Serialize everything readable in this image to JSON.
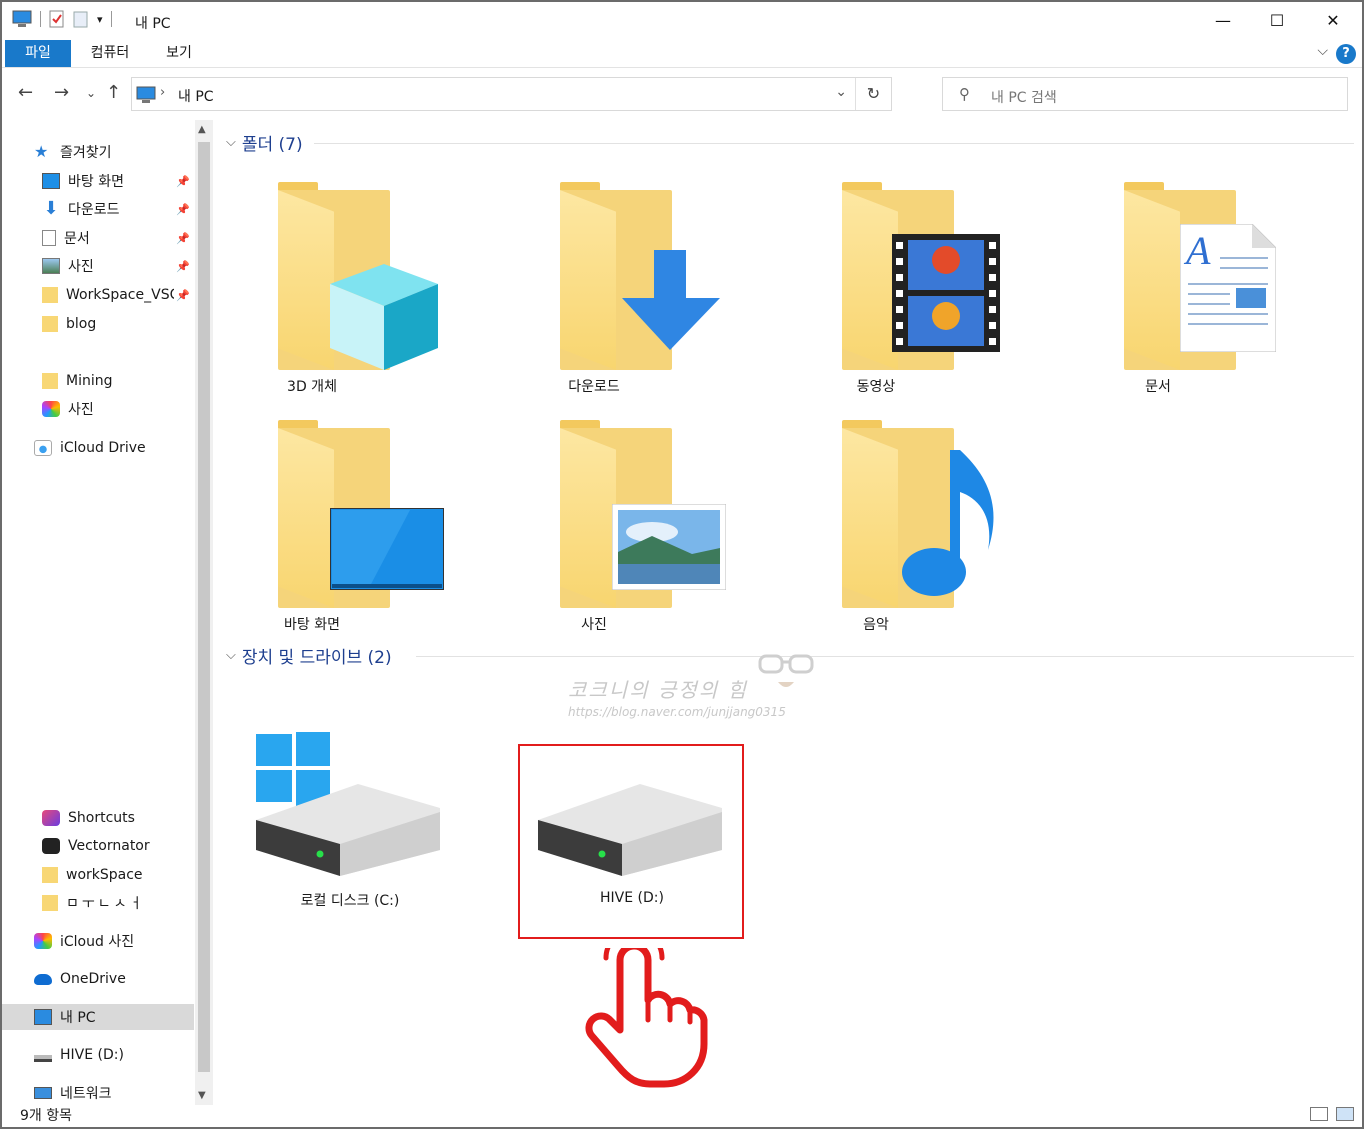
{
  "window": {
    "title": "내 PC",
    "controls": {
      "minimize": "—",
      "maximize": "☐",
      "close": "✕"
    }
  },
  "ribbon": {
    "tabs": [
      {
        "label": "파일",
        "active": true
      },
      {
        "label": "컴퓨터",
        "active": false
      },
      {
        "label": "보기",
        "active": false
      }
    ],
    "help": "?"
  },
  "address": {
    "crumb": "내 PC",
    "refresh": "↻"
  },
  "search": {
    "placeholder": "내 PC 검색"
  },
  "nav_pane": {
    "items": [
      {
        "label": "즐겨찾기",
        "icon": "star-icon"
      },
      {
        "label": "바탕 화면",
        "icon": "desktop-icon",
        "pinned": true
      },
      {
        "label": "다운로드",
        "icon": "download-icon",
        "pinned": true
      },
      {
        "label": "문서",
        "icon": "document-icon",
        "pinned": true
      },
      {
        "label": "사진",
        "icon": "pictures-icon",
        "pinned": true
      },
      {
        "label": "WorkSpace_VSCode",
        "icon": "folder-icon",
        "pinned": true
      },
      {
        "label": "blog",
        "icon": "folder-icon"
      },
      {
        "label": "Mining",
        "icon": "folder-icon"
      },
      {
        "label": "사진",
        "icon": "photos-app-icon"
      },
      {
        "label": "iCloud Drive",
        "icon": "icloud-icon"
      },
      {
        "label": "Shortcuts",
        "icon": "shortcuts-app-icon"
      },
      {
        "label": "Vectornator",
        "icon": "vectornator-app-icon"
      },
      {
        "label": "workSpace",
        "icon": "folder-icon"
      },
      {
        "label": "ㅁㅜㄴㅅㅓ",
        "icon": "folder-icon"
      },
      {
        "label": "iCloud 사진",
        "icon": "photos-app-icon"
      },
      {
        "label": "OneDrive",
        "icon": "onedrive-icon"
      },
      {
        "label": "내 PC",
        "icon": "pc-icon",
        "selected": true
      },
      {
        "label": "HIVE (D:)",
        "icon": "drive-icon"
      },
      {
        "label": "네트워크",
        "icon": "network-icon"
      }
    ]
  },
  "content": {
    "folders_header": "폴더 (7)",
    "folders": [
      {
        "label": "3D 개체",
        "icon": "3d-objects-icon"
      },
      {
        "label": "다운로드",
        "icon": "downloads-folder-icon"
      },
      {
        "label": "동영상",
        "icon": "videos-folder-icon"
      },
      {
        "label": "문서",
        "icon": "documents-folder-icon"
      },
      {
        "label": "바탕 화면",
        "icon": "desktop-folder-icon"
      },
      {
        "label": "사진",
        "icon": "pictures-folder-icon"
      },
      {
        "label": "음악",
        "icon": "music-folder-icon"
      }
    ],
    "devices_header": "장치 및 드라이브 (2)",
    "drives": [
      {
        "label": "로컬 디스크 (C:)",
        "icon": "windows-drive-icon"
      },
      {
        "label": "HIVE (D:)",
        "icon": "drive-icon",
        "highlighted": true
      }
    ]
  },
  "watermark": {
    "line1": "코크니의 긍정의 힘",
    "line2": "https://blog.naver.com/junjjang0315"
  },
  "status": {
    "text": "9개 항목"
  },
  "colors": {
    "accent": "#1979ca",
    "group_header": "#1e3f8f",
    "highlight_box": "#e21c1c"
  }
}
